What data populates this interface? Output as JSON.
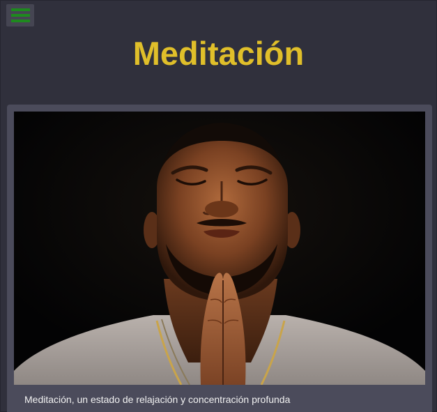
{
  "header": {
    "menu_icon": "hamburger-menu-icon",
    "title": "Meditación"
  },
  "figure": {
    "image_subject": "man with eyes closed and hands pressed together in prayer",
    "caption": "Meditación, un estado de relajación y concentración profunda"
  },
  "colors": {
    "background": "#30303c",
    "title": "#e0bf2a",
    "menu_bars": "#1e8a1e",
    "card": "#4b4b5b",
    "caption_text": "#f2f2f2"
  }
}
